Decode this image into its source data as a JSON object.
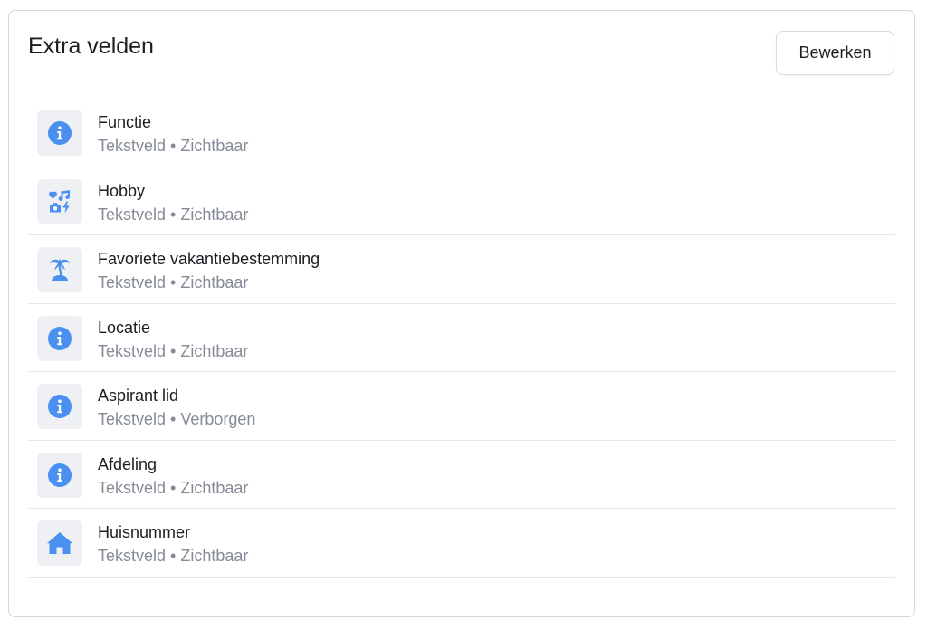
{
  "panel": {
    "title": "Extra velden",
    "edit_label": "Bewerken"
  },
  "colors": {
    "icon": "#4a90f0",
    "icon_bg": "#eff0f3"
  },
  "fields": [
    {
      "name": "Functie",
      "type": "Tekstveld",
      "separator": "•",
      "visibility": "Zichtbaar",
      "icon": "info-icon"
    },
    {
      "name": "Hobby",
      "type": "Tekstveld",
      "separator": "•",
      "visibility": "Zichtbaar",
      "icon": "hobby-icon"
    },
    {
      "name": "Favoriete vakantiebestemming",
      "type": "Tekstveld",
      "separator": "•",
      "visibility": "Zichtbaar",
      "icon": "palm-tree-icon"
    },
    {
      "name": "Locatie",
      "type": "Tekstveld",
      "separator": "•",
      "visibility": "Zichtbaar",
      "icon": "info-icon"
    },
    {
      "name": "Aspirant lid",
      "type": "Tekstveld",
      "separator": "•",
      "visibility": "Verborgen",
      "icon": "info-icon"
    },
    {
      "name": "Afdeling",
      "type": "Tekstveld",
      "separator": "•",
      "visibility": "Zichtbaar",
      "icon": "info-icon"
    },
    {
      "name": "Huisnummer",
      "type": "Tekstveld",
      "separator": "•",
      "visibility": "Zichtbaar",
      "icon": "house-icon"
    }
  ]
}
